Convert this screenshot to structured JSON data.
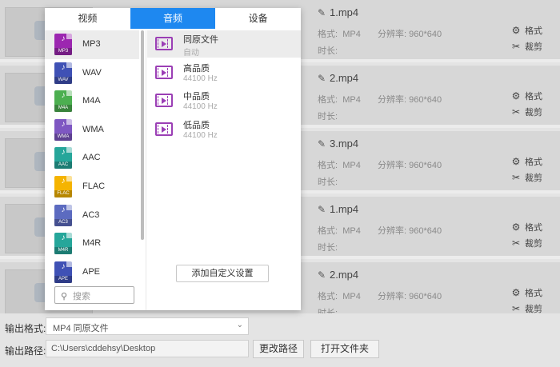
{
  "popup": {
    "tabs": [
      "视频",
      "音频",
      "设备"
    ],
    "active_tab": 1,
    "formats": [
      {
        "name": "MP3",
        "tag": "MP3",
        "color": "#9c27b0"
      },
      {
        "name": "WAV",
        "tag": "WAV",
        "color": "#3f51b5"
      },
      {
        "name": "M4A",
        "tag": "M4A",
        "color": "#4caf50"
      },
      {
        "name": "WMA",
        "tag": "WMA",
        "color": "#7e57c2"
      },
      {
        "name": "AAC",
        "tag": "AAC",
        "color": "#26a69a"
      },
      {
        "name": "FLAC",
        "tag": "FLAC",
        "color": "#f5b400"
      },
      {
        "name": "AC3",
        "tag": "AC3",
        "color": "#5c6bc0"
      },
      {
        "name": "M4R",
        "tag": "M4R",
        "color": "#26a69a"
      },
      {
        "name": "APE",
        "tag": "APE",
        "color": "#3f51b5"
      }
    ],
    "selected_format": 0,
    "search_placeholder": "搜索",
    "qualities": [
      {
        "name": "同原文件",
        "sub": "自动"
      },
      {
        "name": "高品质",
        "sub": "44100 Hz"
      },
      {
        "name": "中品质",
        "sub": "44100 Hz"
      },
      {
        "name": "低品质",
        "sub": "44100 Hz"
      }
    ],
    "selected_quality": 0,
    "custom_button": "添加自定义设置"
  },
  "files": [
    {
      "name": "1.mp4",
      "format_label": "格式:",
      "format": "MP4",
      "res_label": "分辨率:",
      "resolution": "960*640",
      "duration_label": "时长:"
    },
    {
      "name": "2.mp4",
      "format_label": "格式:",
      "format": "MP4",
      "res_label": "分辨率:",
      "resolution": "960*640",
      "duration_label": "时长:"
    },
    {
      "name": "3.mp4",
      "format_label": "格式:",
      "format": "MP4",
      "res_label": "分辨率:",
      "resolution": "960*640",
      "duration_label": "时长:"
    },
    {
      "name": "1.mp4",
      "format_label": "格式:",
      "format": "MP4",
      "res_label": "分辨率:",
      "resolution": "960*640",
      "duration_label": "时长:"
    },
    {
      "name": "2.mp4",
      "format_label": "格式:",
      "format": "MP4",
      "res_label": "分辨率:",
      "resolution": "960*640",
      "duration_label": "时长:"
    }
  ],
  "row_actions": {
    "format": "格式",
    "cut": "裁剪"
  },
  "bottom": {
    "output_format_label": "输出格式:",
    "output_format_value": "MP4  同原文件",
    "output_path_label": "输出路径:",
    "output_path_value": "C:\\Users\\cddehsy\\Desktop",
    "change_path_button": "更改路径",
    "open_folder_button": "打开文件夹"
  },
  "colors": {
    "accent": "#1e88f0",
    "video_icon": "#9b3fb5"
  }
}
